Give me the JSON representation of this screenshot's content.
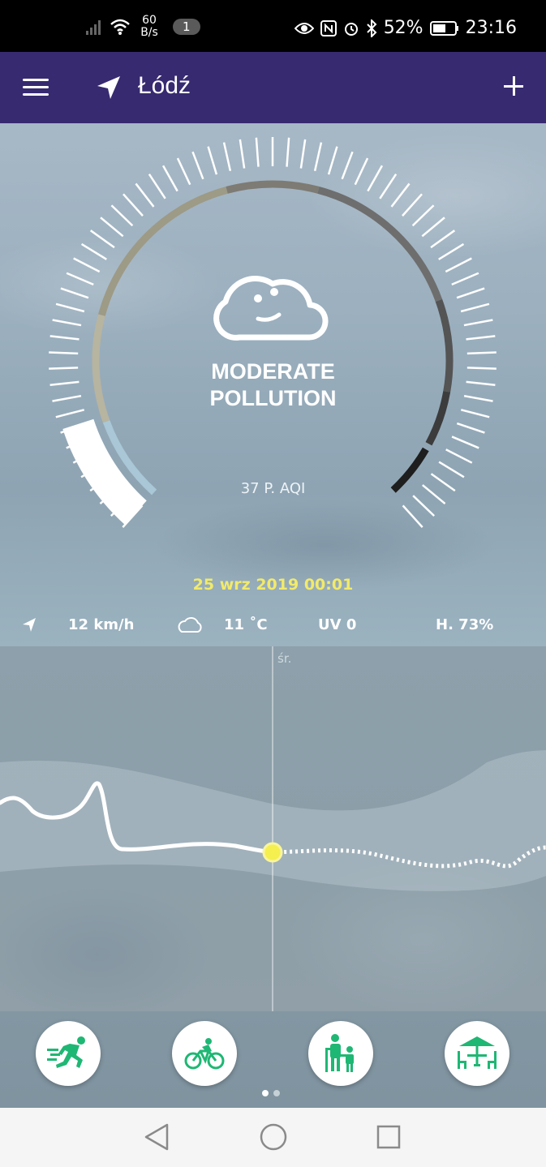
{
  "status_bar": {
    "net_speed_value": "60",
    "net_speed_unit": "B/s",
    "notification_count": "1",
    "battery": "52%",
    "time": "23:16"
  },
  "app_bar": {
    "city": "Łódź"
  },
  "gauge": {
    "status_line1": "MODERATE",
    "status_line2": "POLLUTION",
    "aqi_label": "37 P. AQI",
    "aqi_value": 37,
    "date": "25 wrz 2019 00:01"
  },
  "weather": {
    "wind": "12 km/h",
    "temperature": "11 ˚C",
    "uv": "UV 0",
    "humidity": "H. 73%"
  },
  "forecast_chart": {
    "day_label": "śr."
  },
  "activities": [
    {
      "name": "running"
    },
    {
      "name": "cycling"
    },
    {
      "name": "elderly-children"
    },
    {
      "name": "outdoor-dining"
    }
  ],
  "pager": {
    "count": 2,
    "active": 0
  },
  "colors": {
    "app_bar": "#372a70",
    "accent_green": "#1fb774",
    "date_yellow": "#f2ea6a",
    "current_marker": "#f5ef50"
  }
}
